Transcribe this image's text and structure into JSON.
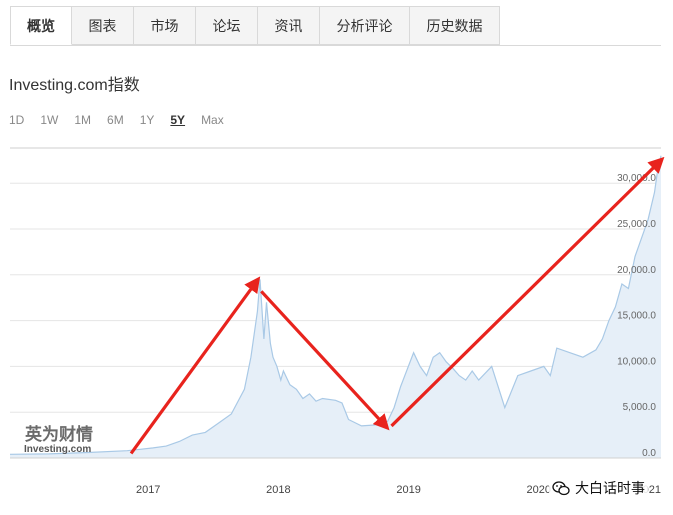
{
  "tabs": [
    {
      "label": "概览",
      "active": true
    },
    {
      "label": "图表"
    },
    {
      "label": "市场"
    },
    {
      "label": "论坛"
    },
    {
      "label": "资讯"
    },
    {
      "label": "分析评论"
    },
    {
      "label": "历史数据"
    }
  ],
  "title": "Investing.com指数",
  "ranges": [
    {
      "label": "1D"
    },
    {
      "label": "1W"
    },
    {
      "label": "1M"
    },
    {
      "label": "6M"
    },
    {
      "label": "1Y"
    },
    {
      "label": "5Y",
      "active": true
    },
    {
      "label": "Max"
    }
  ],
  "watermark": {
    "line1": "英为财情",
    "line2": "Investing.com"
  },
  "wechat": {
    "label": "大白话时事",
    "icon": "wechat-icon"
  },
  "colors": {
    "line": "#a9c9e6",
    "fill": "#e6eff8",
    "arrow": "#e8231d",
    "accent": "#1a1a1a"
  },
  "chart_data": {
    "type": "area",
    "yticks": [
      "0.0",
      "5,000.0",
      "10,000.0",
      "15,000.0",
      "20,000.0",
      "25,000.0",
      "30,000.0"
    ],
    "xticks": [
      "2017",
      "2018",
      "2019",
      "2020",
      "2021"
    ],
    "ylim": [
      0,
      33000
    ],
    "grid": true,
    "x": [
      2016.0,
      2016.3,
      2016.6,
      2016.9,
      2017.0,
      2017.1,
      2017.2,
      2017.3,
      2017.4,
      2017.5,
      2017.6,
      2017.7,
      2017.8,
      2017.85,
      2017.9,
      2017.92,
      2017.95,
      2017.97,
      2018.0,
      2018.02,
      2018.05,
      2018.08,
      2018.1,
      2018.15,
      2018.2,
      2018.25,
      2018.3,
      2018.35,
      2018.4,
      2018.5,
      2018.55,
      2018.6,
      2018.7,
      2018.8,
      2018.85,
      2018.9,
      2018.95,
      2019.0,
      2019.1,
      2019.15,
      2019.2,
      2019.25,
      2019.3,
      2019.35,
      2019.4,
      2019.45,
      2019.5,
      2019.55,
      2019.6,
      2019.7,
      2019.8,
      2019.9,
      2020.0,
      2020.1,
      2020.15,
      2020.2,
      2020.3,
      2020.4,
      2020.5,
      2020.55,
      2020.6,
      2020.65,
      2020.7,
      2020.75,
      2020.8,
      2020.85,
      2020.9,
      2020.95,
      2020.97,
      2021.0
    ],
    "y": [
      400,
      450,
      600,
      800,
      950,
      1100,
      1300,
      1800,
      2500,
      2800,
      3800,
      4800,
      7500,
      11000,
      16000,
      19500,
      13000,
      17000,
      12500,
      11000,
      10000,
      8500,
      9500,
      8000,
      7500,
      6500,
      7000,
      6200,
      6500,
      6300,
      6000,
      4200,
      3500,
      3600,
      3800,
      4000,
      5500,
      7800,
      11500,
      10000,
      9000,
      11000,
      11500,
      10500,
      9800,
      9000,
      8500,
      9500,
      8500,
      10000,
      5500,
      9000,
      9500,
      10000,
      9000,
      12000,
      11500,
      11000,
      11800,
      13000,
      15000,
      16500,
      19000,
      18500,
      22000,
      24000,
      26000,
      29000,
      31000,
      33000
    ],
    "annotations": [
      {
        "type": "arrow",
        "from": [
          2016.93,
          500
        ],
        "to": [
          2017.9,
          19400
        ]
      },
      {
        "type": "arrow",
        "from": [
          2017.93,
          18200
        ],
        "to": [
          2018.89,
          3400
        ]
      },
      {
        "type": "arrow",
        "from": [
          2018.93,
          3500
        ],
        "to": [
          2021.0,
          32500
        ]
      }
    ]
  }
}
